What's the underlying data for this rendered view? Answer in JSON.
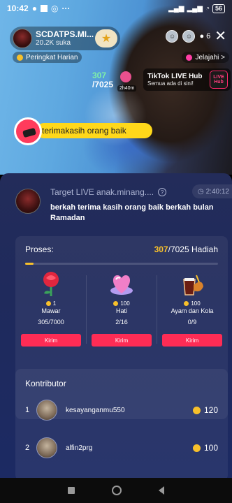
{
  "status_bar": {
    "time": "10:42",
    "more": "···",
    "battery": "56"
  },
  "live": {
    "host_name": "SCDATPS.MI...",
    "host_likes": "20.2K suka",
    "viewer_count": "6",
    "rank_chip": "Peringkat Harian",
    "explore_chip": "Jelajahi >",
    "goal_mini": {
      "current": "307",
      "target": "/7025",
      "timer": "2h40m"
    },
    "hub": {
      "title": "TikTok LIVE Hub",
      "subtitle": "Semua ada di sini!",
      "logo": "LIVE Hub"
    },
    "sticker_text": "terimakasih orang baik"
  },
  "panel": {
    "title": "Target LIVE anak.minang....",
    "timer": "2:40:12",
    "description": "berkah terima kasih orang baik berkah bulan Ramadan",
    "progress": {
      "label": "Proses:",
      "current": "307",
      "target": "/7025 Hadiah",
      "fraction": 0.0437
    },
    "gifts": [
      {
        "price": "1",
        "name": "Mawar",
        "count": "305/7000",
        "button": "Kirim",
        "icon": "rose-icon",
        "color": "#e0263e"
      },
      {
        "price": "100",
        "name": "Hati",
        "count": "2/16",
        "button": "Kirim",
        "icon": "heart-icon",
        "color": "#f07fc8"
      },
      {
        "price": "100",
        "name": "Ayam dan Kola",
        "count": "0/9",
        "button": "Kirim",
        "icon": "chicken-cola-icon",
        "color": "#c8442a"
      }
    ],
    "contributors": {
      "heading": "Kontributor",
      "rows": [
        {
          "rank": "1",
          "name": "kesayanganmu550",
          "amount": "120"
        },
        {
          "rank": "2",
          "name": "alfin2prg",
          "amount": "100"
        }
      ]
    }
  },
  "colors": {
    "accent": "#fe2c55",
    "coin": "#f7c02b",
    "panel": "#1f2a5c"
  }
}
